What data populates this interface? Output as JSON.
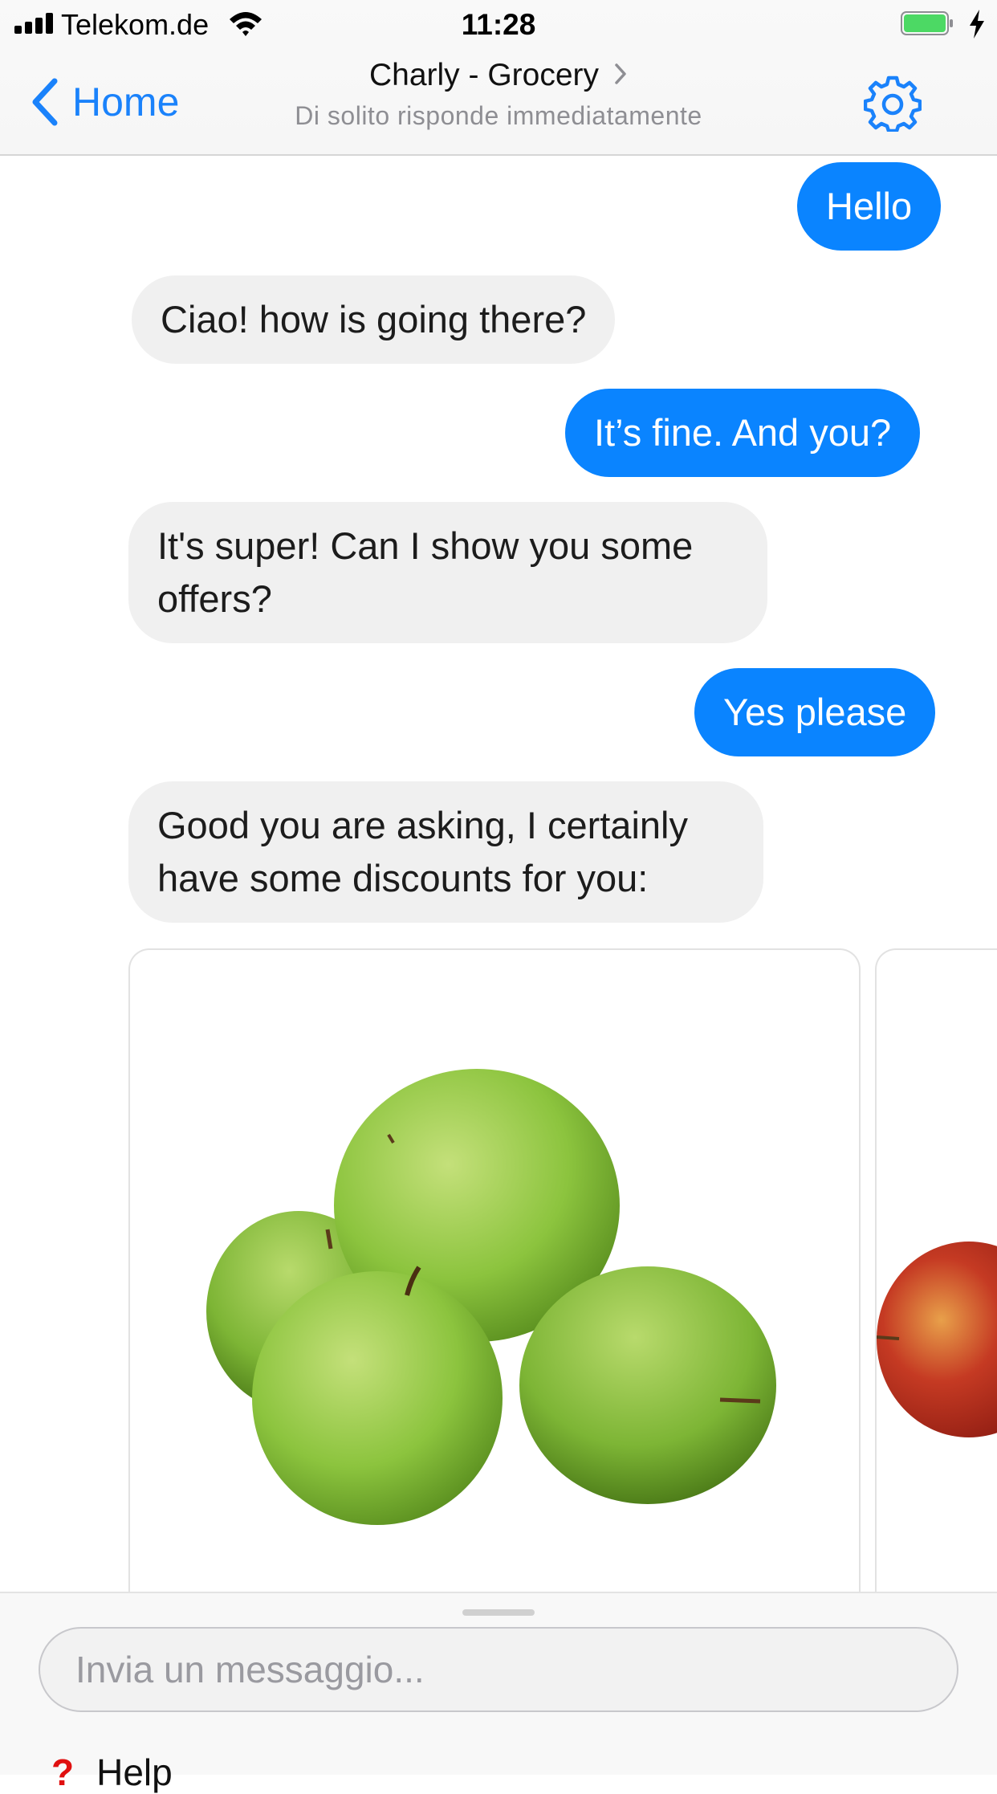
{
  "status_bar": {
    "carrier": "Telekom.de",
    "time": "11:28"
  },
  "nav": {
    "back_label": "Home",
    "title": "Charly - Grocery",
    "subtitle": "Di solito risponde immediatamente"
  },
  "messages": [
    {
      "from": "user",
      "text": "Hello"
    },
    {
      "from": "bot",
      "text": "Ciao! how is going there?"
    },
    {
      "from": "user",
      "text": "It’s fine. And you?"
    },
    {
      "from": "bot",
      "text": "It's super! Can I show you some offers?"
    },
    {
      "from": "user",
      "text": "Yes please"
    },
    {
      "from": "bot",
      "text": "Good you are asking, I certainly have some discounts for you:"
    }
  ],
  "cards": [
    {
      "image": "green-apples-image"
    },
    {
      "image": "red-apple-image"
    }
  ],
  "composer": {
    "placeholder": "Invia un messaggio...",
    "help_icon": "question-mark-icon",
    "help_label": "Help"
  },
  "colors": {
    "accent": "#0a84ff",
    "incoming_bubble": "#f0f0f0",
    "battery": "#4cd964",
    "help_icon": "#e01010"
  }
}
